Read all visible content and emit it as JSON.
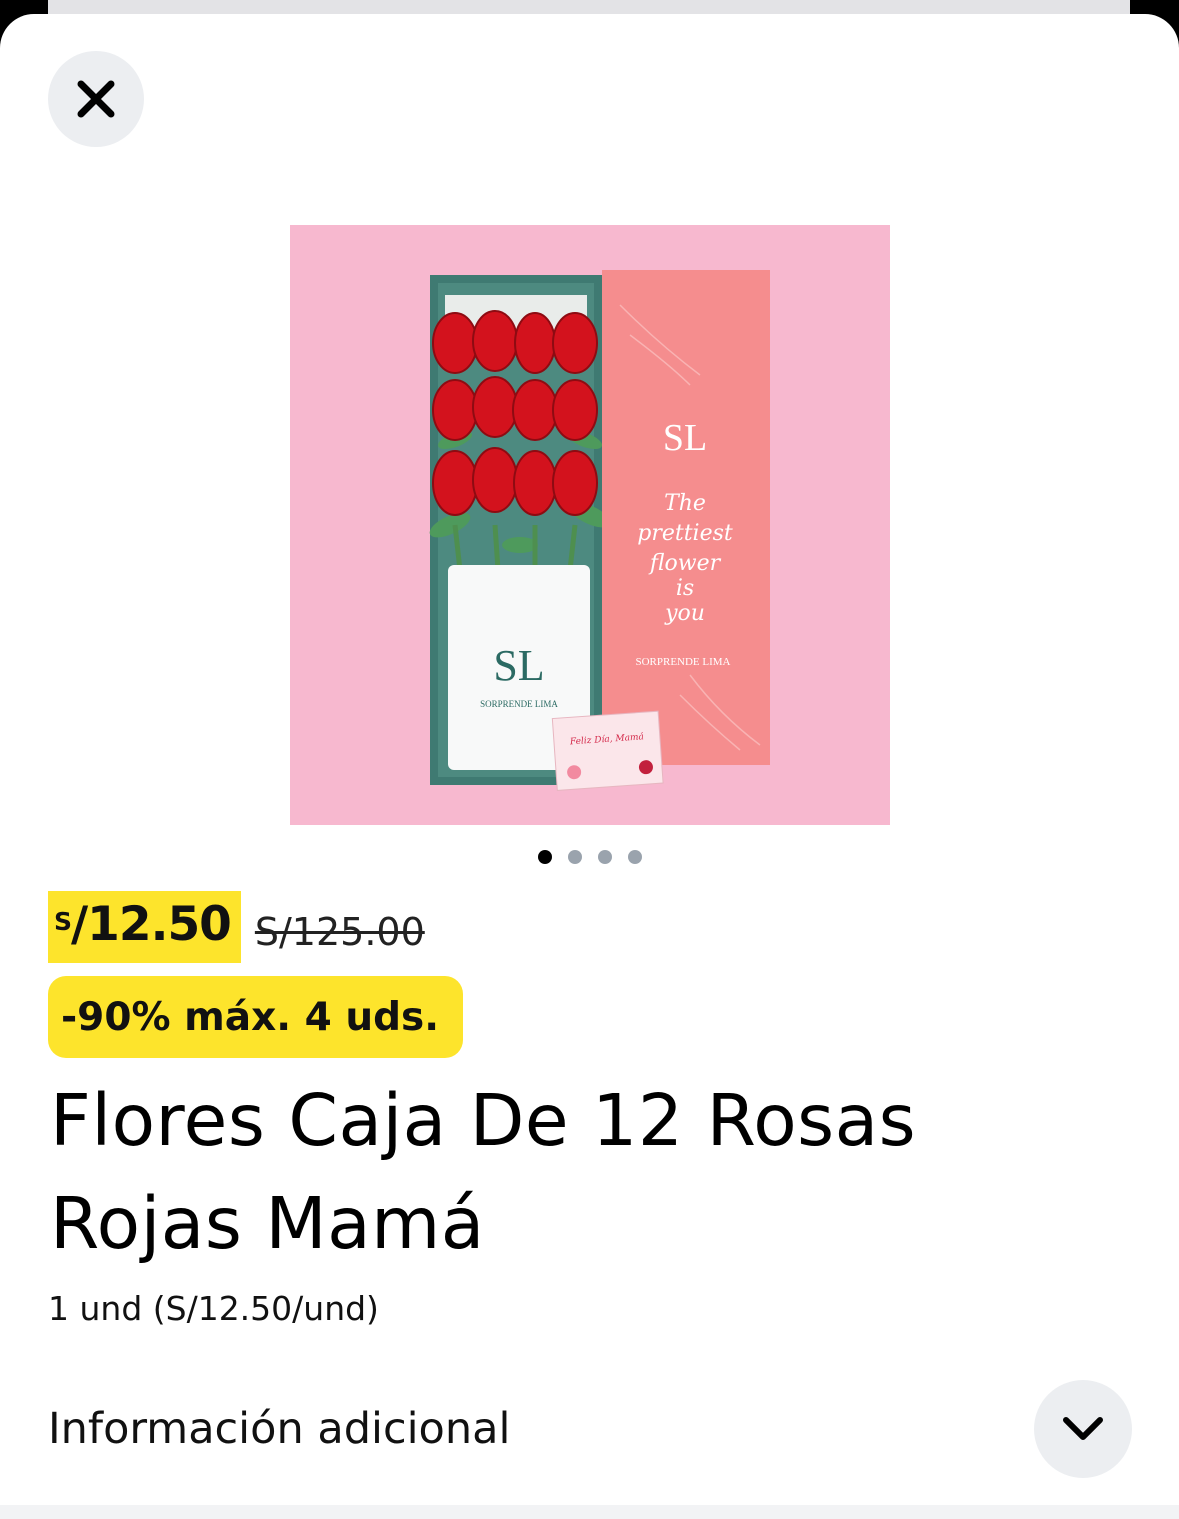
{
  "product": {
    "price_currency": "S",
    "price_amount": "/12.50",
    "price_old": "S/125.00",
    "promo": "-90% máx. 4 uds.",
    "title": "Flores Caja De 12 Rosas Rojas Mamá",
    "unit_price": "1 und (S/12.50/und)",
    "image": {
      "box_logo": "SL",
      "box_text": [
        "The",
        "prettiest",
        "flower",
        "is",
        "you"
      ],
      "box_brand": "SORPRENDE LIMA",
      "card_text": "Feliz Día, Mamá"
    }
  },
  "carousel": {
    "count": 4,
    "active_index": 0
  },
  "info": {
    "label": "Información adicional"
  },
  "icons": {
    "close": "close-icon",
    "expand": "chevron-down-icon"
  },
  "colors": {
    "highlight": "#fde42c",
    "button_bg": "#eceef1",
    "image_bg": "#f7b8cf"
  }
}
